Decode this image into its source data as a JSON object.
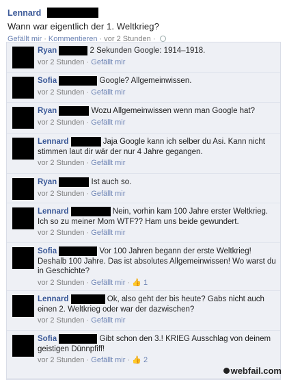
{
  "post": {
    "author": "Lennard",
    "text": "Wann war eigentlich der 1. Weltkrieg?",
    "like_label": "Gefällt mir",
    "comment_label": "Kommentieren",
    "time": "vor 2 Stunden",
    "separator": "·",
    "privacy_icon": "globe-icon"
  },
  "comments": [
    {
      "author": "Ryan",
      "text": "2 Sekunden Google: 1914–1918.",
      "time": "vor 2 Stunden",
      "like_label": "Gefällt mir",
      "likes": ""
    },
    {
      "author": "Sofia",
      "text": "Google? Allgemeinwissen.",
      "time": "vor 2 Stunden",
      "like_label": "Gefällt mir",
      "likes": ""
    },
    {
      "author": "Ryan",
      "text": "Wozu Allgemeinwissen wenn man Google hat?",
      "time": "vor 2 Stunden",
      "like_label": "Gefällt mir",
      "likes": ""
    },
    {
      "author": "Lennard",
      "text": "Jaja Google kann ich selber du Asi. Kann nicht stimmen laut dir wär der nur 4 Jahre gegangen.",
      "time": "vor 2 Stunden",
      "like_label": "Gefällt mir",
      "likes": ""
    },
    {
      "author": "Ryan",
      "text": "Ist auch so.",
      "time": "vor 2 Stunden",
      "like_label": "Gefällt mir",
      "likes": ""
    },
    {
      "author": "Lennard",
      "text": "Nein, vorhin kam 100 Jahre erster Weltkrieg. Ich so zu meiner Mom WTF?? Ham uns beide gewundert.",
      "time": "vor 2 Stunden",
      "like_label": "Gefällt mir",
      "likes": ""
    },
    {
      "author": "Sofia",
      "text": "Vor 100 Jahren begann der erste Weltkrieg! Deshalb 100 Jahre. Das ist absolutes Allgemeinwissen! Wo warst du in Geschichte?",
      "time": "vor 2 Stunden",
      "like_label": "Gefällt mir",
      "likes": "1"
    },
    {
      "author": "Lennard",
      "text": "Ok, also geht der bis heute? Gabs nicht auch einen 2. Weltkrieg oder war der dazwischen?",
      "time": "vor 2 Stunden",
      "like_label": "Gefällt mir",
      "likes": ""
    },
    {
      "author": "Sofia",
      "text": "Gibt schon den 3.! KRIEG Ausschlag von deinem geistigen Dünnpfiff!",
      "time": "vor 2 Stunden",
      "like_label": "Gefällt mir",
      "likes": "2"
    }
  ],
  "watermark": "webfail.com",
  "colors": {
    "link": "#3b5998",
    "meta": "#7f7f7f",
    "comment_bg": "#eef0f5"
  }
}
